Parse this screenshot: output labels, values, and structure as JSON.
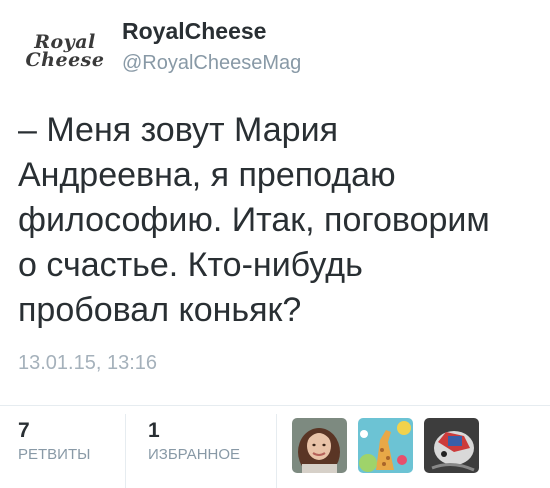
{
  "user": {
    "name": "RoyalCheese",
    "handle": "@RoyalCheeseMag",
    "avatar_logo_top": "Royal",
    "avatar_logo_bottom": "Cheese"
  },
  "tweet": {
    "lines": [
      "– Меня зовут Мария",
      "Андреевна, я преподаю",
      "философию. Итак, поговорим",
      "о счастье. Кто-нибудь",
      "пробовал коньяк?"
    ],
    "timestamp": "13.01.15, 13:16"
  },
  "stats": {
    "retweets_count": "7",
    "retweets_label": "РЕТВИТЫ",
    "favorites_count": "1",
    "favorites_label": "ИЗБРАННОЕ"
  },
  "colors": {
    "text": "#292f33",
    "secondary": "#8899a6",
    "timestamp": "#a5b1bb",
    "divider": "#e6ecf0"
  }
}
